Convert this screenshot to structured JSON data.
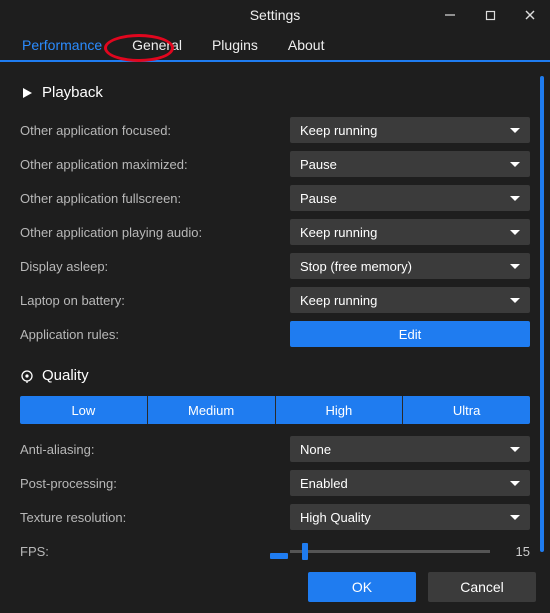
{
  "window": {
    "title": "Settings"
  },
  "tabs": {
    "performance": "Performance",
    "general": "General",
    "plugins": "Plugins",
    "about": "About",
    "active": "performance"
  },
  "playback": {
    "section_label": "Playback",
    "rows": {
      "other_focused": {
        "label": "Other application focused:",
        "value": "Keep running"
      },
      "other_maximized": {
        "label": "Other application maximized:",
        "value": "Pause"
      },
      "other_fullscreen": {
        "label": "Other application fullscreen:",
        "value": "Pause"
      },
      "other_audio": {
        "label": "Other application playing audio:",
        "value": "Keep running"
      },
      "display_asleep": {
        "label": "Display asleep:",
        "value": "Stop (free memory)"
      },
      "laptop_battery": {
        "label": "Laptop on battery:",
        "value": "Keep running"
      },
      "app_rules": {
        "label": "Application rules:",
        "button": "Edit"
      }
    }
  },
  "quality": {
    "section_label": "Quality",
    "presets": {
      "low": "Low",
      "medium": "Medium",
      "high": "High",
      "ultra": "Ultra"
    },
    "rows": {
      "anti_aliasing": {
        "label": "Anti-aliasing:",
        "value": "None"
      },
      "post_processing": {
        "label": "Post-processing:",
        "value": "Enabled"
      },
      "texture_resolution": {
        "label": "Texture resolution:",
        "value": "High Quality"
      },
      "fps": {
        "label": "FPS:",
        "value": "15",
        "slider_percent": 6
      }
    }
  },
  "footer": {
    "ok": "OK",
    "cancel": "Cancel"
  },
  "colors": {
    "accent": "#1f7cf0",
    "annotation": "#e1061e"
  }
}
